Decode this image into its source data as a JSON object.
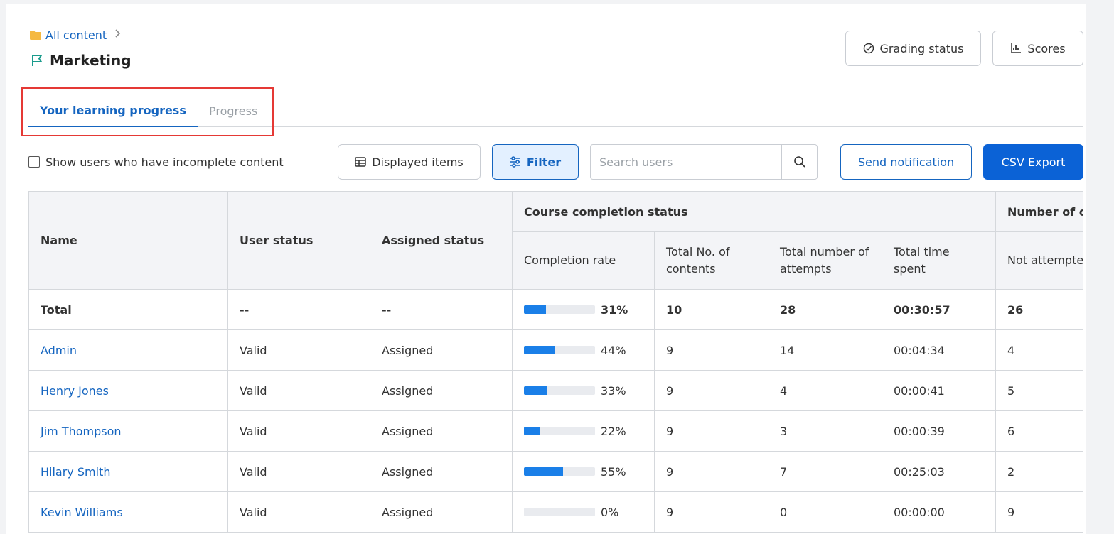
{
  "breadcrumb": {
    "root_label": "All content"
  },
  "page": {
    "title": "Marketing"
  },
  "header_buttons": {
    "grading_status": "Grading status",
    "scores": "Scores"
  },
  "tabs": [
    {
      "label": "Your learning progress",
      "active": true
    },
    {
      "label": "Progress",
      "active": false
    }
  ],
  "toolbar": {
    "incomplete_checkbox_label": "Show users who have incomplete content",
    "incomplete_checked": false,
    "displayed_items": "Displayed items",
    "filter": "Filter",
    "search_placeholder": "Search users",
    "search_value": "",
    "send_notification": "Send notification",
    "csv_export": "CSV Export"
  },
  "table": {
    "headers": {
      "name": "Name",
      "user_status": "User status",
      "assigned_status": "Assigned status",
      "course_completion": "Course completion status",
      "completion_rate": "Completion rate",
      "total_contents": "Total No. of contents",
      "total_attempts": "Total number of attempts",
      "total_time": "Total time spent",
      "number_of": "Number of c",
      "not_attempted": "Not attempted"
    },
    "rows": [
      {
        "name": "Total",
        "user_status": "--",
        "assigned_status": "--",
        "completion_rate": 31,
        "completion_label": "31%",
        "total_contents": "10",
        "total_attempts": "28",
        "total_time": "00:30:57",
        "not_attempted": "26"
      },
      {
        "name": "Admin",
        "user_status": "Valid",
        "assigned_status": "Assigned",
        "completion_rate": 44,
        "completion_label": "44%",
        "total_contents": "9",
        "total_attempts": "14",
        "total_time": "00:04:34",
        "not_attempted": "4"
      },
      {
        "name": "Henry Jones",
        "user_status": "Valid",
        "assigned_status": "Assigned",
        "completion_rate": 33,
        "completion_label": "33%",
        "total_contents": "9",
        "total_attempts": "4",
        "total_time": "00:00:41",
        "not_attempted": "5"
      },
      {
        "name": "Jim Thompson",
        "user_status": "Valid",
        "assigned_status": "Assigned",
        "completion_rate": 22,
        "completion_label": "22%",
        "total_contents": "9",
        "total_attempts": "3",
        "total_time": "00:00:39",
        "not_attempted": "6"
      },
      {
        "name": "Hilary Smith",
        "user_status": "Valid",
        "assigned_status": "Assigned",
        "completion_rate": 55,
        "completion_label": "55%",
        "total_contents": "9",
        "total_attempts": "7",
        "total_time": "00:25:03",
        "not_attempted": "2"
      },
      {
        "name": "Kevin Williams",
        "user_status": "Valid",
        "assigned_status": "Assigned",
        "completion_rate": 0,
        "completion_label": "0%",
        "total_contents": "9",
        "total_attempts": "0",
        "total_time": "00:00:00",
        "not_attempted": "9"
      }
    ]
  },
  "icons": {
    "folder": "folder-icon",
    "chevron": "chevron-right-icon",
    "flag": "flag-icon",
    "grading": "grading-icon",
    "scores": "bar-chart-icon",
    "table": "table-icon",
    "filter": "sliders-icon",
    "search": "search-icon"
  },
  "colors": {
    "accent": "#1565c0",
    "primary_button": "#0b62d6",
    "progress_fill": "#1a7fe8",
    "folder": "#f5b942",
    "flag": "#1a9b8c",
    "highlight_border": "#e53935"
  }
}
